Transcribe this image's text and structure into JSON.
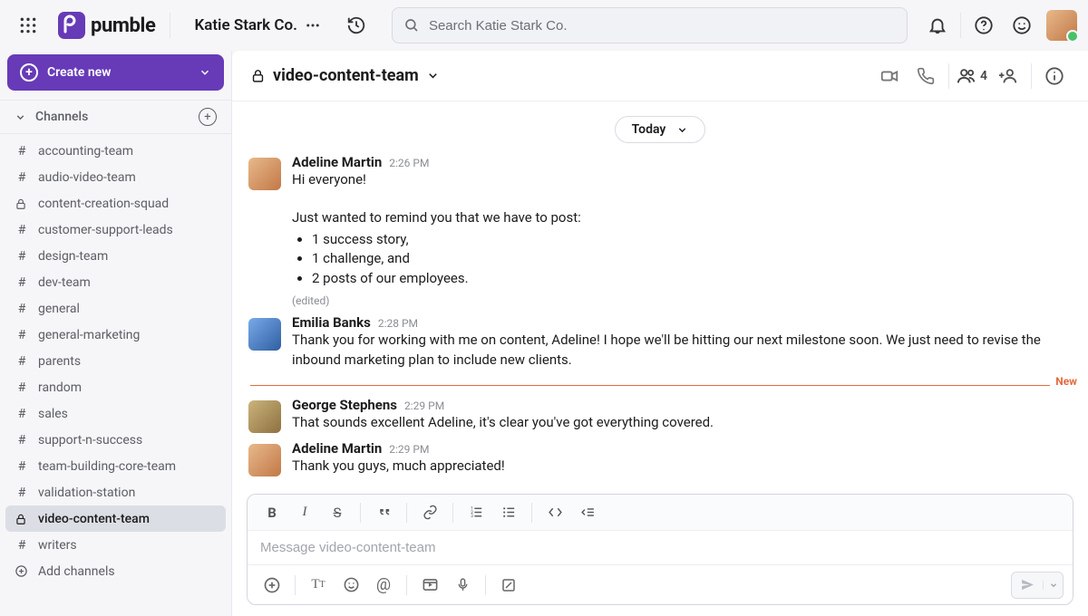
{
  "brand": {
    "name": "pumble"
  },
  "workspace": {
    "name": "Katie Stark Co."
  },
  "search": {
    "placeholder": "Search Katie Stark Co."
  },
  "create_label": "Create new",
  "sidebar": {
    "section_label": "Channels",
    "add_label": "Add channels",
    "items": [
      {
        "name": "accounting-team",
        "locked": false
      },
      {
        "name": "audio-video-team",
        "locked": false
      },
      {
        "name": "content-creation-squad",
        "locked": true
      },
      {
        "name": "customer-support-leads",
        "locked": false
      },
      {
        "name": "design-team",
        "locked": false
      },
      {
        "name": "dev-team",
        "locked": false
      },
      {
        "name": "general",
        "locked": false
      },
      {
        "name": "general-marketing",
        "locked": false
      },
      {
        "name": "parents",
        "locked": false
      },
      {
        "name": "random",
        "locked": false
      },
      {
        "name": "sales",
        "locked": false
      },
      {
        "name": "support-n-success",
        "locked": false
      },
      {
        "name": "team-building-core-team",
        "locked": false
      },
      {
        "name": "validation-station",
        "locked": false
      },
      {
        "name": "video-content-team",
        "locked": true,
        "active": true
      },
      {
        "name": "writers",
        "locked": false
      }
    ]
  },
  "channel": {
    "name": "video-content-team",
    "member_count": "4",
    "date_label": "Today",
    "new_label": "New"
  },
  "messages": [
    {
      "author": "Adeline Martin",
      "time": "2:26 PM",
      "intro": "Hi everyone!",
      "remind_line": "Just wanted to remind you that we have to post:",
      "bullets": [
        "1 success story,",
        "1 challenge, and",
        "2 posts of our employees."
      ],
      "edited": "(edited)"
    },
    {
      "author": "Emilia Banks",
      "time": "2:28 PM",
      "text": "Thank you for working with me on content, Adeline! I hope we'll be hitting our next milestone soon. We just need to revise the inbound marketing plan to include new clients."
    },
    {
      "author": "George Stephens",
      "time": "2:29 PM",
      "text": "That sounds excellent Adeline, it's clear you've got everything covered."
    },
    {
      "author": "Adeline Martin",
      "time": "2:29 PM",
      "text": "Thank you guys, much appreciated!"
    }
  ],
  "composer": {
    "placeholder": "Message video-content-team"
  }
}
